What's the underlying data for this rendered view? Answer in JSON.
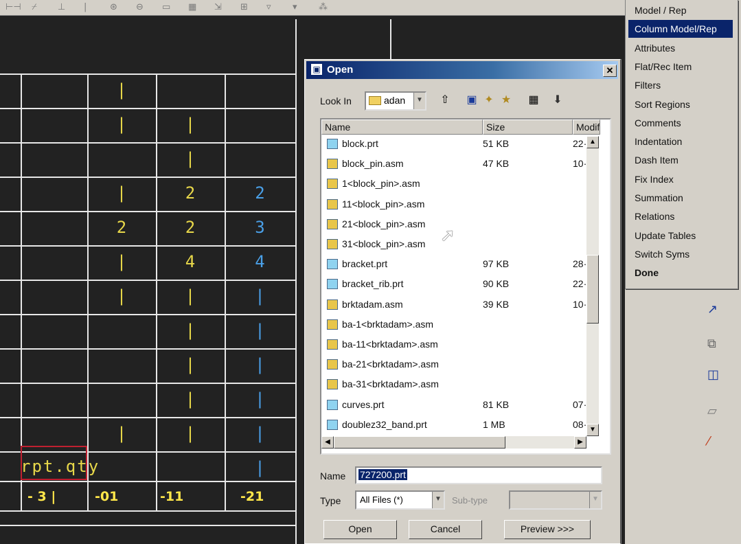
{
  "toolbar": {
    "glyphs": [
      "⊢⊣",
      "⌿",
      "⊥",
      "|",
      "⊛",
      "⊖",
      "▭",
      "▦",
      "⇲",
      "⊞",
      "▿",
      "▾",
      "⁂"
    ]
  },
  "table": {
    "col_b": [
      "|",
      "|",
      "",
      "|",
      "2",
      "|",
      "|",
      "",
      "",
      "",
      "|"
    ],
    "col_c": [
      "",
      "|",
      "|",
      "2",
      "2",
      "4",
      "|",
      "|",
      "|",
      "|",
      "|"
    ],
    "col_d": [
      "",
      "",
      "",
      "2",
      "3",
      "4",
      "|",
      "|",
      "|",
      "|",
      "|",
      "|"
    ],
    "label": "rpt.qty",
    "suffixes": [
      "- 3 |",
      "-01",
      "-11",
      "-21"
    ]
  },
  "menu": {
    "items": [
      {
        "label": "Model / Rep"
      },
      {
        "label": "Column Model/Rep",
        "selected": true
      },
      {
        "label": "Attributes"
      },
      {
        "label": "Flat/Rec Item"
      },
      {
        "label": "Filters"
      },
      {
        "label": "Sort Regions"
      },
      {
        "label": "Comments"
      },
      {
        "label": "Indentation"
      },
      {
        "label": "Dash Item"
      },
      {
        "label": "Fix Index"
      },
      {
        "label": "Summation"
      },
      {
        "label": "Relations"
      },
      {
        "label": "Update Tables"
      },
      {
        "label": "Switch Syms"
      },
      {
        "label": "Done",
        "bold": true
      }
    ]
  },
  "right_icons": [
    "↗",
    "⧉",
    "◫",
    "▱",
    "⁄"
  ],
  "dialog": {
    "title": "Open",
    "close_glyph": "✕",
    "look_in_label": "Look In",
    "look_in_value": "adan",
    "columns": {
      "name": "Name",
      "size": "Size",
      "modified": "Modifi"
    },
    "files": [
      {
        "name": "block.prt",
        "size": "51 KB",
        "modified": "22·",
        "kind": "prt"
      },
      {
        "name": "block_pin.asm",
        "size": "47 KB",
        "modified": "10·",
        "kind": "asm"
      },
      {
        "name": "1<block_pin>.asm",
        "size": "",
        "modified": "",
        "kind": "asm"
      },
      {
        "name": "11<block_pin>.asm",
        "size": "",
        "modified": "",
        "kind": "asm"
      },
      {
        "name": "21<block_pin>.asm",
        "size": "",
        "modified": "",
        "kind": "asm"
      },
      {
        "name": "31<block_pin>.asm",
        "size": "",
        "modified": "",
        "kind": "asm"
      },
      {
        "name": "bracket.prt",
        "size": "97 KB",
        "modified": "28·",
        "kind": "prt"
      },
      {
        "name": "bracket_rib.prt",
        "size": "90 KB",
        "modified": "22·",
        "kind": "prt"
      },
      {
        "name": "brktadam.asm",
        "size": "39 KB",
        "modified": "10·",
        "kind": "asm"
      },
      {
        "name": "ba-1<brktadam>.asm",
        "size": "",
        "modified": "",
        "kind": "asm"
      },
      {
        "name": "ba-11<brktadam>.asm",
        "size": "",
        "modified": "",
        "kind": "asm"
      },
      {
        "name": "ba-21<brktadam>.asm",
        "size": "",
        "modified": "",
        "kind": "asm"
      },
      {
        "name": "ba-31<brktadam>.asm",
        "size": "",
        "modified": "",
        "kind": "asm"
      },
      {
        "name": "curves.prt",
        "size": "81 KB",
        "modified": "07·",
        "kind": "prt"
      },
      {
        "name": "doublez32_band.prt",
        "size": "1 MB",
        "modified": "08·",
        "kind": "prt"
      }
    ],
    "name_label": "Name",
    "name_value": "727200.prt",
    "type_label": "Type",
    "type_value": "All Files (*)",
    "subtype_label": "Sub-type",
    "subtype_value": "",
    "buttons": {
      "open": "Open",
      "cancel": "Cancel",
      "preview": "Preview >>>"
    }
  }
}
